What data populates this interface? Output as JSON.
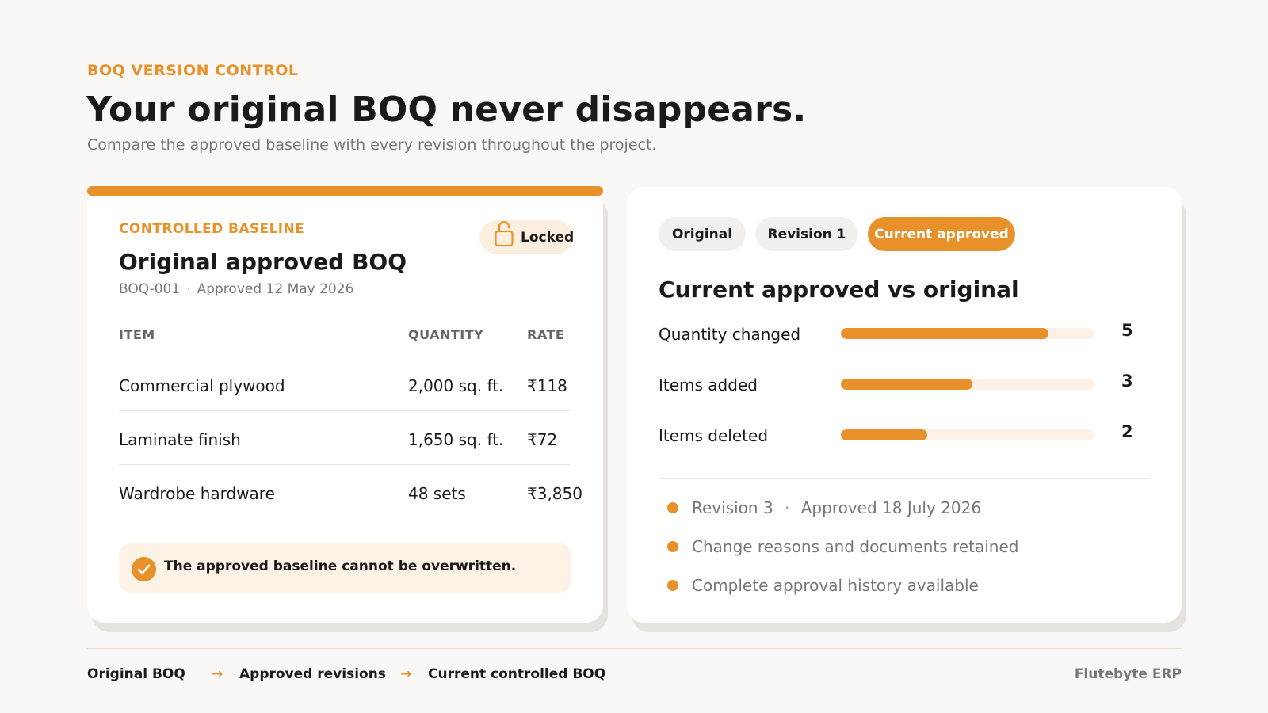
{
  "header": {
    "eyebrow": "BOQ VERSION CONTROL",
    "title": "Your original BOQ never disappears.",
    "subtitle": "Compare the approved baseline with every revision throughout the project."
  },
  "baseline_card": {
    "label": "CONTROLLED BASELINE",
    "lock_status": "Locked",
    "lock_icon": "unlocked-padlock-icon",
    "title": "Original approved BOQ",
    "boq_id": "BOQ-001",
    "separator": "·",
    "approved": "Approved 12 May 2026",
    "table": {
      "headers": [
        "ITEM",
        "QUANTITY",
        "RATE"
      ],
      "rows": [
        [
          "Commercial plywood",
          "2,000 sq. ft.",
          "₹118"
        ],
        [
          "Laminate finish",
          "1,650 sq. ft.",
          "₹72"
        ],
        [
          "Wardrobe hardware",
          "48 sets",
          "₹3,850"
        ]
      ]
    },
    "notice": "The approved baseline cannot be overwritten.",
    "notice_icon": "check-circle-icon"
  },
  "comparison_card": {
    "tabs": [
      {
        "label": "Original",
        "active": false
      },
      {
        "label": "Revision 1",
        "active": false
      },
      {
        "label": "Current approved",
        "active": true
      }
    ],
    "title": "Current approved vs original",
    "metrics": [
      {
        "label": "Quantity changed",
        "value": "5",
        "fill_fraction": 0.82
      },
      {
        "label": "Items added",
        "value": "3",
        "fill_fraction": 0.52
      },
      {
        "label": "Items deleted",
        "value": "2",
        "fill_fraction": 0.34
      }
    ],
    "bullets": [
      {
        "text": "Revision 3",
        "sep": "·",
        "extra": "Approved 18 July 2026"
      },
      {
        "text": "Change reasons and documents retained"
      },
      {
        "text": "Complete approval history available"
      }
    ]
  },
  "footer": {
    "flow": [
      "Original BOQ",
      "Approved revisions",
      "Current controlled BOQ"
    ],
    "arrow": "→",
    "brand": "Flutebyte ERP"
  },
  "colors": {
    "accent": "#e8902a",
    "accent_light": "#fdf1e5",
    "text": "#1a1a1a",
    "muted": "#777777"
  }
}
